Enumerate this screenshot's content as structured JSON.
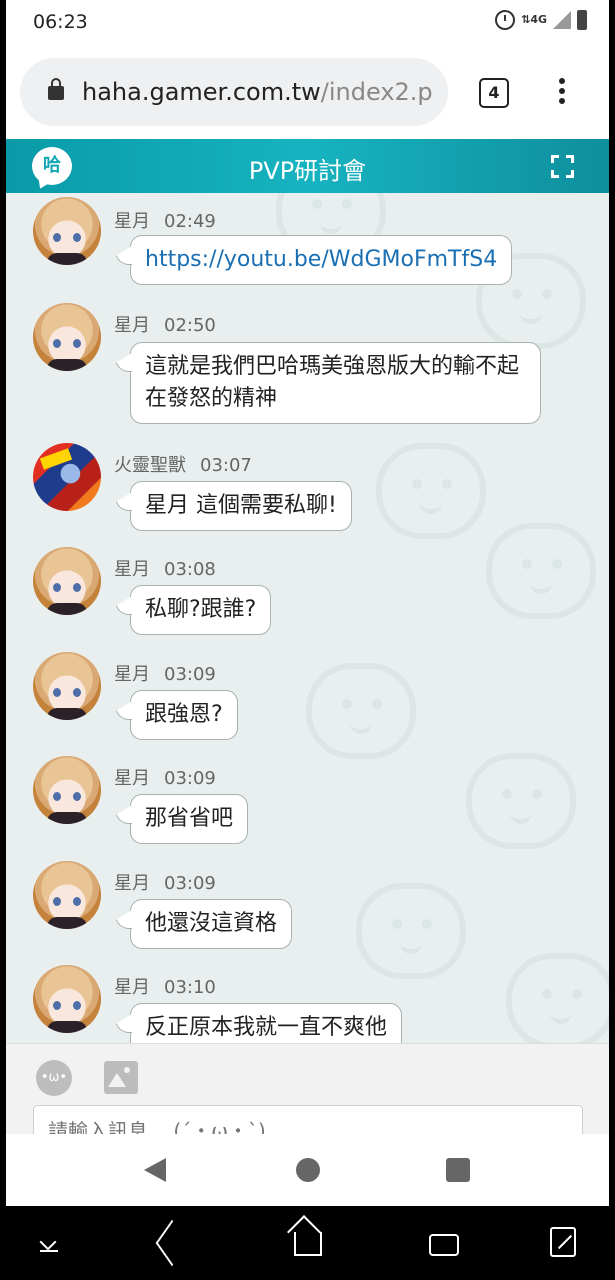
{
  "status_bar": {
    "time": "06:23",
    "network": "4G",
    "icons": [
      "alarm-icon",
      "data-arrows-icon",
      "signal-icon",
      "battery-icon"
    ]
  },
  "browser": {
    "url_host": "haha.gamer.com.tw",
    "url_path": "/index2.p",
    "tab_count": "4",
    "icons": [
      "lock-icon",
      "menu-icon"
    ]
  },
  "chat_header": {
    "logo_text": "哈",
    "title": "PVP研討會",
    "icons": [
      "haha-logo-icon",
      "fullscreen-icon"
    ]
  },
  "messages": [
    {
      "sender": "星月",
      "time": "02:49",
      "text": "https://youtu.be/WdGMoFmTfS4",
      "is_link": true
    },
    {
      "sender": "星月",
      "time": "02:50",
      "text": "這就是我們巴哈瑪美強恩版大的輸不起在發怒的精神"
    },
    {
      "sender": "火靈聖獸",
      "time": "03:07",
      "text": "星月 這個需要私聊!"
    },
    {
      "sender": "星月",
      "time": "03:08",
      "text": "私聊?跟誰?"
    },
    {
      "sender": "星月",
      "time": "03:09",
      "text": "跟強恩?"
    },
    {
      "sender": "星月",
      "time": "03:09",
      "text": "那省省吧"
    },
    {
      "sender": "星月",
      "time": "03:09",
      "text": "他還沒這資格"
    },
    {
      "sender": "星月",
      "time": "03:10",
      "text": "反正原本我就一直不爽他"
    }
  ],
  "composer": {
    "emoji_text": "•ω•",
    "placeholder": "請輸入訊息... (ˊ・ω・ˋ)",
    "icons": [
      "emoji-icon",
      "image-icon"
    ]
  },
  "colors": {
    "header_teal": "#13a6b5",
    "chat_background": "#e9efef",
    "link": "#1a6fb3"
  }
}
